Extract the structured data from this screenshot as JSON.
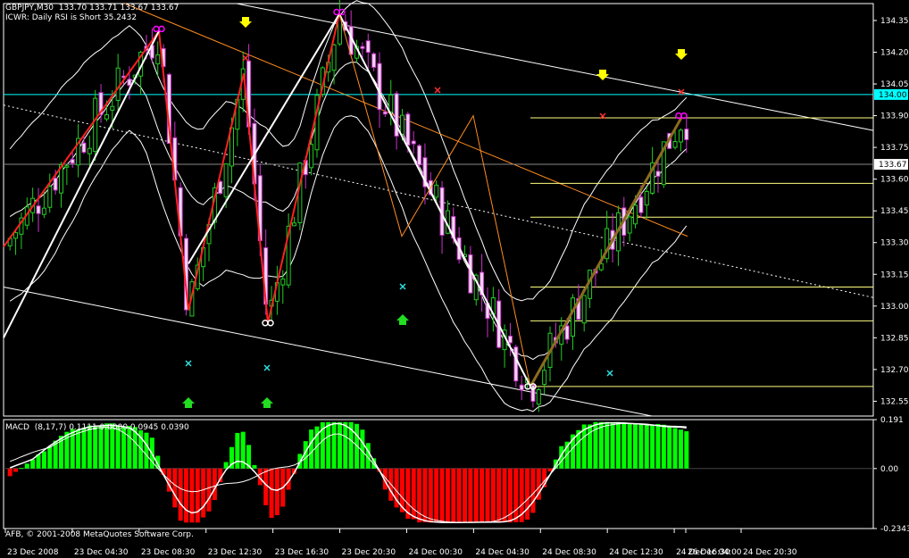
{
  "header": {
    "symbol_line": "GBPJPY,M30  133.70 133.71 133.67 133.67",
    "indicator_line": "ICWR: Daily RSI is Short 35.2432"
  },
  "macd_panel": {
    "label": "MACD  (8,17,7) 0.1111 0.0000 0.0945 0.0390"
  },
  "footer": {
    "copyright": "AFB, © 2001-2008 MetaQuotes Software Corp."
  },
  "price_axis": {
    "ticks": [
      "134.35",
      "134.20",
      "134.05",
      "133.90",
      "133.75",
      "133.60",
      "133.45",
      "133.30",
      "133.15",
      "133.00",
      "132.85",
      "132.70",
      "132.55"
    ],
    "current_price": "133.67",
    "level_label": "134.00"
  },
  "macd_axis": {
    "ticks": [
      "0.191",
      "0.00",
      "-0.2343"
    ]
  },
  "time_axis": {
    "ticks": [
      "23 Dec 2008",
      "23 Dec 04:30",
      "23 Dec 08:30",
      "23 Dec 12:30",
      "23 Dec 16:30",
      "23 Dec 20:30",
      "24 Dec 00:30",
      "24 Dec 04:30",
      "24 Dec 08:30",
      "24 Dec 12:30",
      "24 Dec 16:30",
      "24 Dec 20:30",
      "26 Dec 04:00"
    ]
  },
  "colors": {
    "background": "#000000",
    "bull_candle": "#22cc22",
    "bear_candle": "#ffffff",
    "bear_wick": "#cc33cc",
    "zigzag": "#ff2020",
    "trendline_white": "#ffffff",
    "fib_lines": "#ffff80",
    "level_line": "#00ffff",
    "macd_pos": "#00ff00",
    "macd_neg": "#ff0000",
    "brown_line": "#8b6b20",
    "orange_line": "#ff8c20"
  },
  "chart_data": {
    "type": "candlestick",
    "price_range": [
      132.48,
      134.43
    ],
    "macd_range": [
      -0.2343,
      0.191
    ],
    "zigzag_points": [
      {
        "x": "23 Dec 2008",
        "y": 133.28
      },
      {
        "x": "23 Dec 08:00",
        "y": 134.3
      },
      {
        "x": "23 Dec 12:30",
        "y": 132.98
      },
      {
        "x": "23 Dec 16:00",
        "y": 134.1
      },
      {
        "x": "23 Dec 18:00",
        "y": 132.92
      },
      {
        "x": "24 Dec 00:00",
        "y": 134.38
      },
      {
        "x": "24 Dec 14:30",
        "y": 132.62
      },
      {
        "x": "24 Dec 22:30",
        "y": 133.89
      }
    ],
    "fib_levels": [
      133.89,
      133.58,
      133.42,
      133.09,
      132.93,
      132.62
    ],
    "horizontal_level": 134.0,
    "current_price": 133.67
  }
}
